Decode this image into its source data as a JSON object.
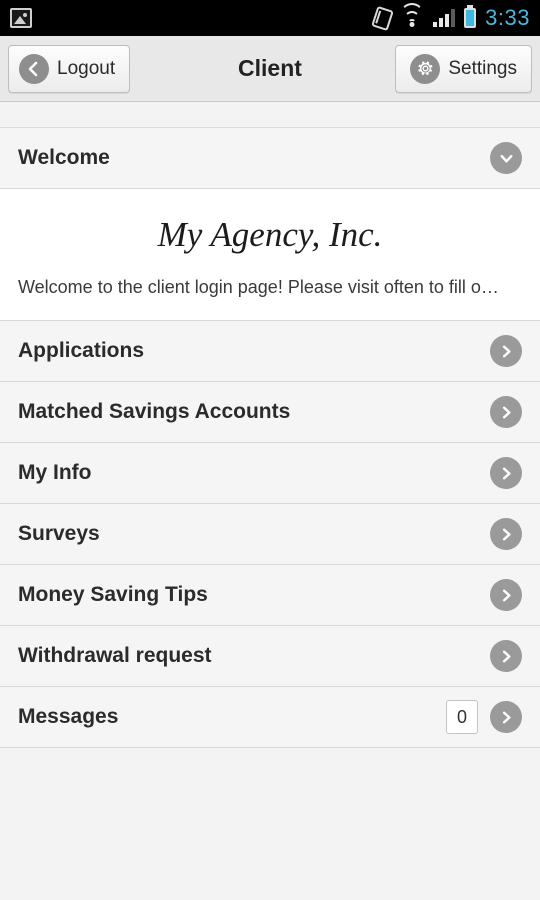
{
  "statusbar": {
    "time": "3:33",
    "icons": [
      "image-icon",
      "rotation-lock-icon",
      "wifi-icon",
      "signal-icon",
      "battery-icon"
    ]
  },
  "actionbar": {
    "back_label": "Logout",
    "title": "Client",
    "settings_label": "Settings"
  },
  "welcome": {
    "header": "Welcome",
    "agency": "My Agency, Inc.",
    "body": "Welcome to the client login page!  Please visit often to fill o…"
  },
  "menu": [
    {
      "label": "Applications",
      "badge": null
    },
    {
      "label": "Matched Savings Accounts",
      "badge": null
    },
    {
      "label": "My Info",
      "badge": null
    },
    {
      "label": "Surveys",
      "badge": null
    },
    {
      "label": "Money Saving Tips",
      "badge": null
    },
    {
      "label": "Withdrawal request",
      "badge": null
    },
    {
      "label": "Messages",
      "badge": "0"
    }
  ],
  "colors": {
    "accent": "#4db5dd",
    "chevron": "#9a9a9a",
    "bar": "#e8e8e8",
    "row": "#f5f5f5"
  }
}
